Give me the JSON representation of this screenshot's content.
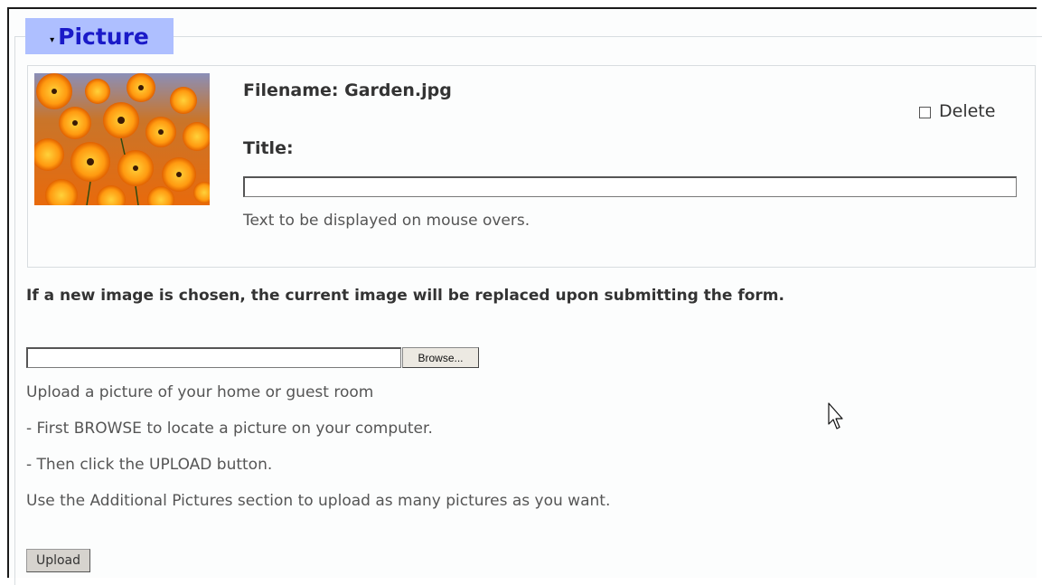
{
  "section": {
    "legend_label": "Picture",
    "legend_arrow": "▾"
  },
  "picture": {
    "filename_text": "Filename: Garden.jpg",
    "delete_label": "Delete",
    "delete_checked": false,
    "title_label": "Title:",
    "title_value": "",
    "title_hint": "Text to be displayed on mouse overs."
  },
  "upload": {
    "replace_note": "If a new image is chosen, the current image will be replaced upon submitting the form.",
    "file_value": "",
    "browse_label": "Browse...",
    "instructions": [
      "Upload a picture of your home or guest room",
      "- First BROWSE to locate a picture on your computer.",
      "- Then click the UPLOAD button.",
      "Use the Additional Pictures section to upload as many pictures as you want."
    ],
    "upload_label": "Upload"
  },
  "colors": {
    "legend_bg": "#aebfff",
    "legend_text": "#1a1ac8"
  },
  "icons": {
    "cursor": "mouse-pointer-icon",
    "thumbnail": "flower-garden-thumbnail"
  }
}
